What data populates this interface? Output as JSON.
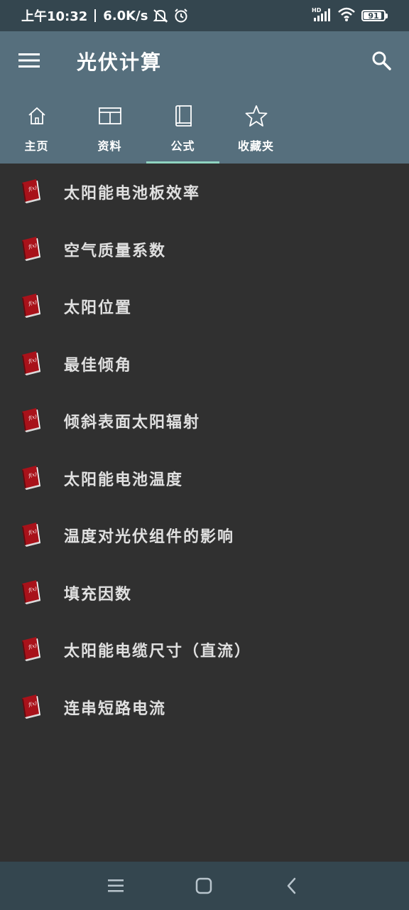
{
  "status_bar": {
    "time": "上午10:32",
    "network_speed": "6.0K/s",
    "battery_level": "91",
    "battery_fraction": 0.91,
    "icons": [
      "mute-icon",
      "alarm-icon",
      "hd-signal-icon",
      "wifi-icon",
      "battery-icon"
    ]
  },
  "header": {
    "title": "光伏计算",
    "menu_icon": "hamburger-menu-icon",
    "search_icon": "search-icon"
  },
  "tabs": [
    {
      "label": "主页",
      "icon": "home-icon",
      "active": false
    },
    {
      "label": "资料",
      "icon": "table-icon",
      "active": false
    },
    {
      "label": "公式",
      "icon": "book-icon",
      "active": true
    },
    {
      "label": "收藏夹",
      "icon": "star-icon",
      "active": false
    }
  ],
  "formulas": [
    {
      "label": "太阳能电池板效率"
    },
    {
      "label": "空气质量系数"
    },
    {
      "label": "太阳位置"
    },
    {
      "label": "最佳倾角"
    },
    {
      "label": "倾斜表面太阳辐射"
    },
    {
      "label": "太阳能电池温度"
    },
    {
      "label": "温度对光伏组件的影响"
    },
    {
      "label": "填充因数"
    },
    {
      "label": "太阳能电缆尺寸（直流）"
    },
    {
      "label": "连串短路电流"
    }
  ],
  "nav_bar": {
    "icons": [
      "recents-icon",
      "home-button-icon",
      "back-icon"
    ]
  },
  "colors": {
    "status_bar": "#34464f",
    "header": "#566f7d",
    "background": "#303030",
    "tab_indicator": "#8fd3c0",
    "book_red": "#a8121a"
  }
}
